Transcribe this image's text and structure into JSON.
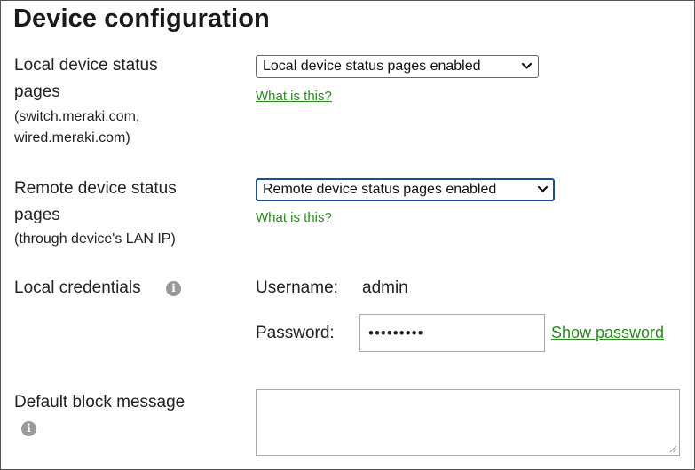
{
  "title": "Device configuration",
  "local_status": {
    "label_line1": "Local device status",
    "label_line2": "pages",
    "sub_line1": "(switch.meraki.com,",
    "sub_line2": "wired.meraki.com)",
    "select_value": "Local device status pages enabled",
    "help_link": "What is this?"
  },
  "remote_status": {
    "label_line1": "Remote device status",
    "label_line2": "pages",
    "sub_line1": "(through device's LAN IP)",
    "select_value": "Remote device status pages enabled",
    "help_link": "What is this?"
  },
  "credentials": {
    "label": "Local credentials",
    "info_glyph": "i",
    "username_label": "Username:",
    "username_value": "admin",
    "password_label": "Password:",
    "password_value": "•••••••••",
    "show_password_link": "Show password"
  },
  "block_message": {
    "label": "Default block message",
    "info_glyph": "i",
    "value": ""
  },
  "colors": {
    "link": "#2a8a1f",
    "focus_border": "#1f4e8c",
    "info_icon": "#9a9a9a"
  },
  "icons": {
    "dropdown": "chevron-down-icon",
    "info": "info-icon",
    "resize": "resize-grip-icon"
  }
}
